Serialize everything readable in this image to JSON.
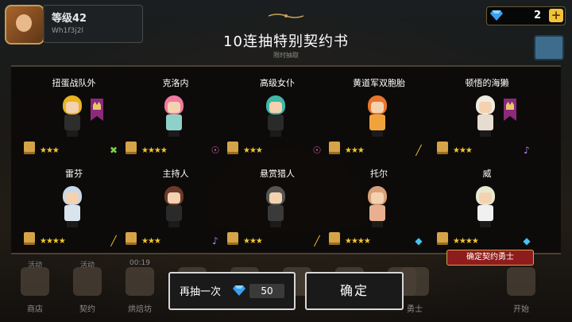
{
  "hud": {
    "player_level": "等级42",
    "player_exp": "Wh1f3j2l",
    "gems": "2"
  },
  "dialog": {
    "title": "10连抽特别契约书",
    "subtitle": "限时抽取"
  },
  "heroes": [
    {
      "name": "扭蛋战队外",
      "stars": "★★★",
      "weapon": "✖",
      "weapon_color": "#7bd04a",
      "hair": "#e8b420",
      "outfit": "#2d2d2d",
      "banner": true
    },
    {
      "name": "克洛内",
      "stars": "★★★★",
      "weapon": "☉",
      "weapon_color": "#d460b0",
      "hair": "#f07aa0",
      "outfit": "#8fd1c9",
      "banner": false
    },
    {
      "name": "高级女仆",
      "stars": "★★★",
      "weapon": "☉",
      "weapon_color": "#d460b0",
      "hair": "#3fb8a8",
      "outfit": "#2a2a2a",
      "banner": false
    },
    {
      "name": "黄道军双胞胎",
      "stars": "★★★",
      "weapon": "╱",
      "weapon_color": "#f2c23a",
      "hair": "#e8762c",
      "outfit": "#f2a23a",
      "banner": false
    },
    {
      "name": "顿悟的海獭",
      "stars": "★★★",
      "weapon": "♪",
      "weapon_color": "#b580f0",
      "hair": "#f0ebe0",
      "outfit": "#e6ddd0",
      "banner": true
    },
    {
      "name": "雷芬",
      "stars": "★★★★",
      "weapon": "╱",
      "weapon_color": "#f2c23a",
      "hair": "#c9d8e8",
      "outfit": "#d9e4ee",
      "banner": false
    },
    {
      "name": "主持人",
      "stars": "★★★",
      "weapon": "♪",
      "weapon_color": "#b580f0",
      "hair": "#6a3a2a",
      "outfit": "#2a2a2a",
      "banner": false
    },
    {
      "name": "悬赏猎人",
      "stars": "★★★",
      "weapon": "╱",
      "weapon_color": "#f2c23a",
      "hair": "#555555",
      "outfit": "#3a3a3a",
      "banner": false
    },
    {
      "name": "托尔",
      "stars": "★★★★",
      "weapon": "◆",
      "weapon_color": "#4ac0f0",
      "hair": "#d8a07a",
      "outfit": "#e8b090",
      "banner": false
    },
    {
      "name": "威",
      "stars": "★★★★",
      "weapon": "◆",
      "weapon_color": "#4ac0f0",
      "hair": "#e8e8d0",
      "outfit": "#f0f0f0",
      "banner": false
    }
  ],
  "confirm_badge": "确定契约勇士",
  "nav": [
    {
      "label": "商店",
      "top": "活动"
    },
    {
      "label": "契约",
      "top": "活动"
    },
    {
      "label": "烘焙坊",
      "top": "00:19"
    },
    {
      "label": "",
      "top": ""
    },
    {
      "label": "",
      "top": ""
    },
    {
      "label": "",
      "top": ""
    },
    {
      "label": "",
      "top": ""
    },
    {
      "label": "",
      "top": ""
    },
    {
      "label": "勇士",
      "top": ""
    },
    {
      "label": "开始",
      "top": ""
    }
  ],
  "actions": {
    "redraw_label": "再抽一次",
    "redraw_cost": "50",
    "confirm_label": "确定"
  },
  "colors": {
    "gem": "#3aa0f0",
    "star": "#f5c531",
    "scroll": "#d6a448",
    "badge_red": "#8f1c1c"
  }
}
